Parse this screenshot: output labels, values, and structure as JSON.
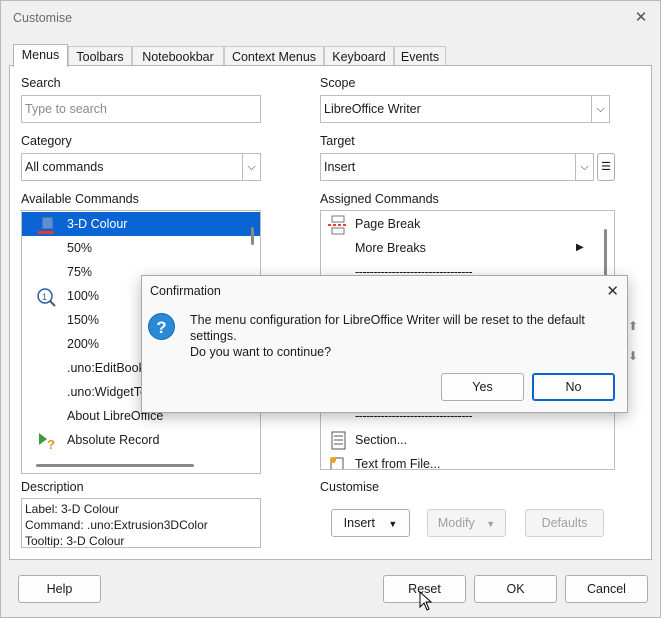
{
  "window": {
    "title": "Customise",
    "close_glyph": "✕"
  },
  "tabs": [
    "Menus",
    "Toolbars",
    "Notebookbar",
    "Context Menus",
    "Keyboard",
    "Events"
  ],
  "search": {
    "label": "Search",
    "placeholder": "Type to search",
    "value": ""
  },
  "category": {
    "label": "Category",
    "value": "All commands"
  },
  "available": {
    "label": "Available Commands",
    "items": [
      {
        "label": "3-D Colour",
        "icon": "cube-color-icon",
        "selected": true
      },
      {
        "label": "50%",
        "icon": ""
      },
      {
        "label": "75%",
        "icon": ""
      },
      {
        "label": "100%",
        "icon": "zoom-100-icon"
      },
      {
        "label": "150%",
        "icon": ""
      },
      {
        "label": "200%",
        "icon": ""
      },
      {
        "label": ".uno:EditBookm",
        "icon": ""
      },
      {
        "label": ".uno:WidgetTe",
        "icon": ""
      },
      {
        "label": "About LibreOffice",
        "icon": ""
      },
      {
        "label": "Absolute Record",
        "icon": "absolute-record-icon"
      }
    ]
  },
  "scope": {
    "label": "Scope",
    "value": "LibreOffice Writer"
  },
  "target": {
    "label": "Target",
    "value": "Insert",
    "menu_glyph": "☰"
  },
  "assigned": {
    "label": "Assigned Commands",
    "items_top": [
      {
        "label": "Page Break",
        "icon": "page-break-icon"
      },
      {
        "label": "More Breaks",
        "icon": "",
        "submenu": true
      },
      {
        "label": "--------------------------------",
        "icon": ""
      }
    ],
    "items_bottom": [
      {
        "label": "--------------------------------",
        "icon": ""
      },
      {
        "label": "Section...",
        "icon": "section-icon"
      },
      {
        "label": "Text from File...",
        "icon": "text-from-file-icon"
      }
    ]
  },
  "description": {
    "label": "Description",
    "lines": [
      "Label: 3-D Colour",
      "Command: .uno:Extrusion3DColor",
      "Tooltip: 3-D Colour"
    ]
  },
  "customise": {
    "label": "Customise",
    "insert": "Insert",
    "modify": "Modify",
    "defaults": "Defaults"
  },
  "bottom_buttons": {
    "help": "Help",
    "reset": "Reset",
    "ok": "OK",
    "cancel": "Cancel"
  },
  "confirmation": {
    "title": "Confirmation",
    "line1": "The menu configuration for LibreOffice Writer will be reset to the default settings.",
    "line2": "Do you want to continue?",
    "yes": "Yes",
    "no": "No",
    "icon": "question-icon"
  },
  "colors": {
    "accent": "#0a64d4",
    "question_icon": "#2a8ad6"
  }
}
